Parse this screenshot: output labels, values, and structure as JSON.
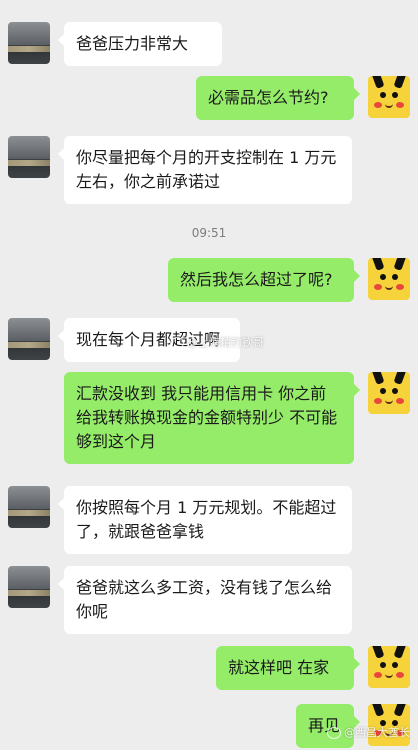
{
  "conversation": {
    "messages": [
      {
        "side": "left",
        "text": "爸爸压力非常大"
      },
      {
        "side": "right",
        "text": "必需品怎么节约?"
      },
      {
        "side": "left",
        "text": "你尽量把每个月的开支控制在 1 万元左右，你之前承诺过"
      },
      {
        "side": "right",
        "text": "然后我怎么超过了呢?"
      },
      {
        "side": "left",
        "text": "现在每个月都超过啊"
      },
      {
        "side": "right",
        "text": "汇款没收到 我只能用信用卡 你之前给我转账换现金的金额特别少 不可能够到这个月"
      },
      {
        "side": "left",
        "text": "你按照每个月 1 万元规划。不能超过了，就跟爸爸拿钱"
      },
      {
        "side": "left",
        "text": "爸爸就这么多工资，没有钱了怎么给你呢"
      },
      {
        "side": "right",
        "text": "就这样吧 在家"
      },
      {
        "side": "right",
        "text": "再见"
      }
    ],
    "timestamp": "09:51"
  },
  "watermarks": {
    "center": "@上海精钓钦哥",
    "bottom": "@西昌大酋长"
  },
  "colors": {
    "background": "#ededed",
    "incoming_bubble": "#ffffff",
    "outgoing_bubble": "#95ec69",
    "text": "#1a1a1a",
    "timestamp": "#7d7d7d"
  }
}
